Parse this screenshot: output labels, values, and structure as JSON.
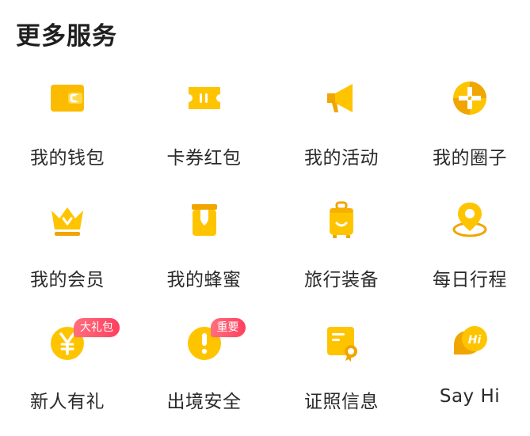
{
  "header": {
    "title": "更多服务"
  },
  "colors": {
    "icon_yellow": "#FFC400",
    "icon_dark_yellow": "#F0A500",
    "badge_red": "#FF4D63"
  },
  "services": [
    {
      "label": "我的钱包",
      "icon": "wallet-icon"
    },
    {
      "label": "卡券红包",
      "icon": "coupon-icon"
    },
    {
      "label": "我的活动",
      "icon": "megaphone-icon"
    },
    {
      "label": "我的圈子",
      "icon": "circle-pinwheel-icon"
    },
    {
      "label": "我的会员",
      "icon": "crown-icon"
    },
    {
      "label": "我的蜂蜜",
      "icon": "honey-jar-icon"
    },
    {
      "label": "旅行装备",
      "icon": "luggage-icon"
    },
    {
      "label": "每日行程",
      "icon": "location-pin-icon"
    },
    {
      "label": "新人有礼",
      "icon": "yen-coin-icon",
      "badge": "大礼包"
    },
    {
      "label": "出境安全",
      "icon": "exclamation-icon",
      "badge": "重要"
    },
    {
      "label": "证照信息",
      "icon": "certificate-icon"
    },
    {
      "label": "Say Hi",
      "icon": "hi-bubble-icon"
    }
  ]
}
